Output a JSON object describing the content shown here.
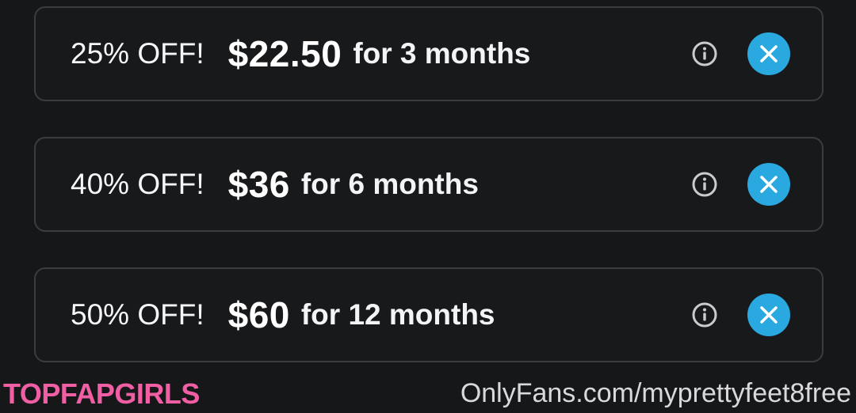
{
  "offers": [
    {
      "discount": "25% OFF!",
      "price": "$22.50",
      "period": "for 3 months",
      "info_icon": "info-icon",
      "close_icon": "close-icon"
    },
    {
      "discount": "40% OFF!",
      "price": "$36",
      "period": "for 6 months",
      "info_icon": "info-icon",
      "close_icon": "close-icon"
    },
    {
      "discount": "50% OFF!",
      "price": "$60",
      "period": "for 12 months",
      "info_icon": "info-icon",
      "close_icon": "close-icon"
    }
  ],
  "watermarks": {
    "left": "TOPFAPGIRLS",
    "right": "OnlyFans.com/myprettyfeet8free"
  },
  "colors": {
    "background": "#161719",
    "card_border": "#3a3c40",
    "close_button": "#2aa8e0",
    "left_watermark": "#f05fa4"
  }
}
